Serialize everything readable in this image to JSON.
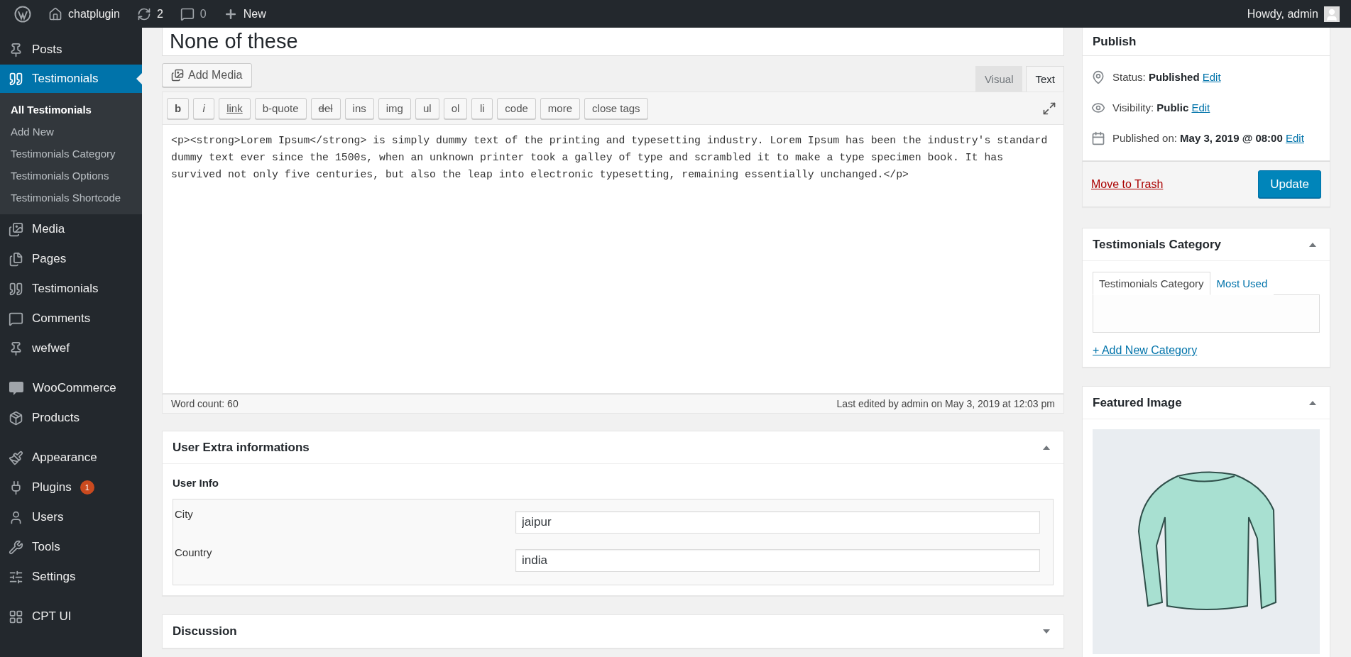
{
  "admin_bar": {
    "site": "chatplugin",
    "updates": "2",
    "comments": "0",
    "new": "New",
    "greeting": "Howdy, admin"
  },
  "sidebar": {
    "groups": [
      {
        "items": [
          {
            "label": "Posts",
            "selected": false
          },
          {
            "label": "Testimonials",
            "selected": true,
            "children": [
              {
                "label": "All Testimonials",
                "selected": true
              },
              {
                "label": "Add New",
                "selected": false
              },
              {
                "label": "Testimonials Category",
                "selected": false
              },
              {
                "label": "Testimonials Options",
                "selected": false
              },
              {
                "label": "Testimonials Shortcode",
                "selected": false
              }
            ]
          },
          {
            "label": "Media",
            "selected": false
          },
          {
            "label": "Pages",
            "selected": false
          },
          {
            "label": "Testimonials",
            "selected": false
          },
          {
            "label": "Comments",
            "selected": false
          },
          {
            "label": "wefwef",
            "selected": false
          }
        ]
      },
      {
        "items": [
          {
            "label": "WooCommerce",
            "selected": false
          },
          {
            "label": "Products",
            "selected": false
          }
        ]
      },
      {
        "items": [
          {
            "label": "Appearance",
            "selected": false
          },
          {
            "label": "Plugins",
            "selected": false,
            "badge": "1"
          },
          {
            "label": "Users",
            "selected": false
          },
          {
            "label": "Tools",
            "selected": false
          },
          {
            "label": "Settings",
            "selected": false
          }
        ]
      },
      {
        "items": [
          {
            "label": "CPT UI",
            "selected": false
          }
        ]
      }
    ]
  },
  "editor": {
    "title": "None of these",
    "add_media": "Add Media",
    "tabs": [
      {
        "label": "Visual",
        "selected": false
      },
      {
        "label": "Text",
        "selected": true
      }
    ],
    "quicktags": [
      {
        "label": "b",
        "kind": "bold"
      },
      {
        "label": "i",
        "kind": "italic"
      },
      {
        "label": "link",
        "kind": "underline"
      },
      {
        "label": "b-quote",
        "kind": "plain"
      },
      {
        "label": "del",
        "kind": "strike"
      },
      {
        "label": "ins",
        "kind": "plain"
      },
      {
        "label": "img",
        "kind": "plain"
      },
      {
        "label": "ul",
        "kind": "plain"
      },
      {
        "label": "ol",
        "kind": "plain"
      },
      {
        "label": "li",
        "kind": "plain"
      },
      {
        "label": "code",
        "kind": "plain"
      },
      {
        "label": "more",
        "kind": "plain"
      },
      {
        "label": "close tags",
        "kind": "plain"
      }
    ],
    "content": "<p><strong>Lorem Ipsum</strong> is simply dummy text of the printing and typesetting industry. Lorem Ipsum has been the industry's standard dummy text ever since the 1500s, when an unknown printer took a galley of type and scrambled it to make a type specimen book. It has survived not only five centuries, but also the leap into electronic typesetting, remaining essentially unchanged.</p>",
    "word_count": "Word count: 60",
    "last_edited": "Last edited by admin on May 3, 2019 at 12:03 pm"
  },
  "meta_boxes": [
    {
      "title": "User Extra informations",
      "expanded": true,
      "section": "User Info",
      "fields": [
        {
          "label": "City",
          "value": "jaipur"
        },
        {
          "label": "Country",
          "value": "india"
        }
      ]
    },
    {
      "title": "Discussion",
      "expanded": false
    }
  ],
  "publish": {
    "title": "Publish",
    "rows": [
      {
        "label": "Status:",
        "value": "Published",
        "link": "Edit"
      },
      {
        "label": "Visibility:",
        "value": "Public",
        "link": "Edit"
      },
      {
        "label": "Published on:",
        "value": "May 3, 2019 @ 08:00",
        "link": "Edit"
      }
    ],
    "trash": "Move to Trash",
    "button": "Update"
  },
  "categories": {
    "title": "Testimonials Category",
    "expanded": true,
    "tabs": [
      {
        "label": "Testimonials Category",
        "selected": true
      },
      {
        "label": "Most Used",
        "selected": false
      }
    ],
    "add_link": "+ Add New Category"
  },
  "featured_image": {
    "title": "Featured Image",
    "expanded": true
  }
}
